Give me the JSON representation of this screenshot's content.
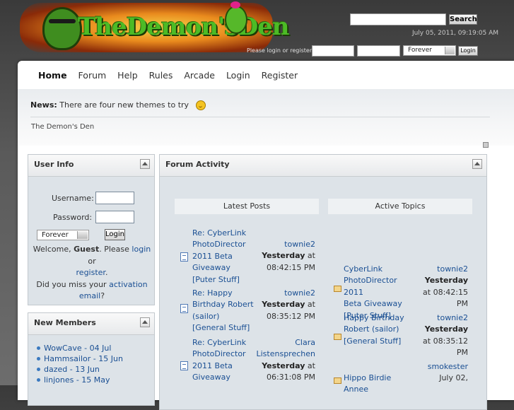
{
  "header": {
    "logo_text": "TheDemon'sDen",
    "search_button": "Search",
    "datetime": "July 05, 2011, 09:19:05 AM",
    "login_prompt": "Please login or register.",
    "session_length": "Forever",
    "login_button": "Login"
  },
  "nav": {
    "items": [
      "Home",
      "Forum",
      "Help",
      "Rules",
      "Arcade",
      "Login",
      "Register"
    ]
  },
  "news": {
    "label": "News:",
    "text": "There are four new themes to try"
  },
  "site_name": "The Demon's Den",
  "user_info": {
    "title": "User Info",
    "username_label": "Username:",
    "password_label": "Password:",
    "session_length": "Forever",
    "login_button": "Login",
    "welcome_prefix": "Welcome, ",
    "guest": "Guest",
    "please": ". Please ",
    "login_link": "login",
    "or": " or",
    "register_link": "register",
    "period": ".",
    "missed_prefix": "Did you miss your ",
    "activation_link": "activation email",
    "question": "?"
  },
  "new_members": {
    "title": "New Members",
    "items": [
      "WowCave - 04 Jul",
      "Hammsailor - 15 Jun",
      "dazed - 13 Jun",
      "linjones - 15 May"
    ]
  },
  "forum_activity": {
    "title": "Forum Activity",
    "latest_posts_header": "Latest Posts",
    "active_topics_header": "Active Topics",
    "latest_posts": [
      {
        "l1": "Re: CyberLink",
        "l2": "PhotoDirector",
        "l3": "2011 Beta",
        "l4": "Giveaway",
        "l5": "[Puter Stuff]",
        "author": "townie2",
        "when": "Yesterday",
        "at": " at",
        "time": "08:42:15 PM"
      },
      {
        "l1": "Re: Happy",
        "l2": "Birthday Robert",
        "l3": "(sailor)",
        "l4": "[General Stuff]",
        "author": "townie2",
        "when": "Yesterday",
        "at": " at",
        "time": "08:35:12 PM"
      },
      {
        "l1": "Re: CyberLink",
        "l2": "PhotoDirector",
        "l3": "2011 Beta",
        "l4": "Giveaway",
        "author1": "Clara",
        "author2": "Listensprechen",
        "when": "Yesterday",
        "at": " at",
        "time": "06:31:08 PM"
      }
    ],
    "active_topics": [
      {
        "l1": "CyberLink",
        "l2": "PhotoDirector 2011",
        "l3": "Beta Giveaway",
        "l4": "[Puter Stuff]",
        "author": "townie2",
        "when": "Yesterday",
        "at": "at 08:42:15",
        "pm": "PM"
      },
      {
        "l1": "Happy Birthday",
        "l2": "Robert (sailor)",
        "l3": "[General Stuff]",
        "author": "townie2",
        "when": "Yesterday",
        "at": "at 08:35:12",
        "pm": "PM"
      },
      {
        "l1": "Hippo Birdie Annee",
        "author": "smokester",
        "when": "July 02,"
      }
    ]
  }
}
